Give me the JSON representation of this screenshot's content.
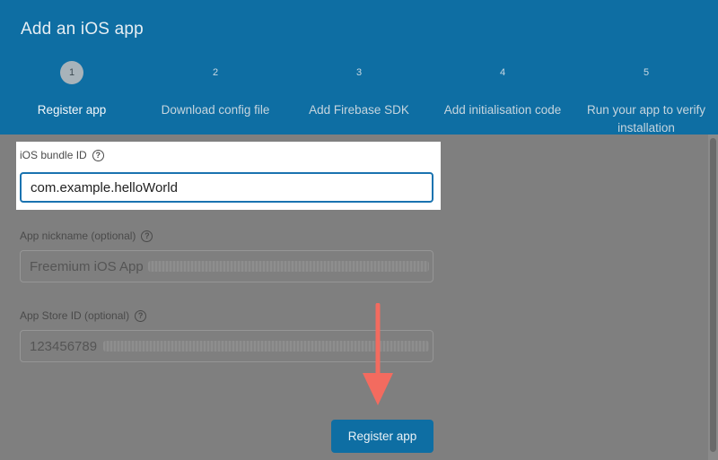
{
  "header": {
    "title": "Add an iOS app",
    "steps": [
      {
        "number": "1",
        "label": "Register app"
      },
      {
        "number": "2",
        "label": "Download config file"
      },
      {
        "number": "3",
        "label": "Add Firebase SDK"
      },
      {
        "number": "4",
        "label": "Add initialisation code"
      },
      {
        "number": "5",
        "label": "Run your app to verify installation"
      }
    ],
    "active_step": 1
  },
  "form": {
    "bundle_id": {
      "label": "iOS bundle ID",
      "value": "com.example.helloWorld",
      "help_icon": "question-circle-icon"
    },
    "nickname": {
      "label": "App nickname (optional)",
      "placeholder": "Freemium iOS App",
      "help_icon": "question-circle-icon"
    },
    "app_store_id": {
      "label": "App Store ID (optional)",
      "placeholder": "123456789",
      "help_icon": "question-circle-icon"
    }
  },
  "actions": {
    "register_label": "Register app"
  },
  "annotation": {
    "arrow_icon": "down-arrow-icon",
    "arrow_color": "#f36b5f"
  },
  "colors": {
    "header_bg": "#0e6ea3",
    "button_bg": "#0e6ea3",
    "overlay": "#7f7f7f"
  }
}
